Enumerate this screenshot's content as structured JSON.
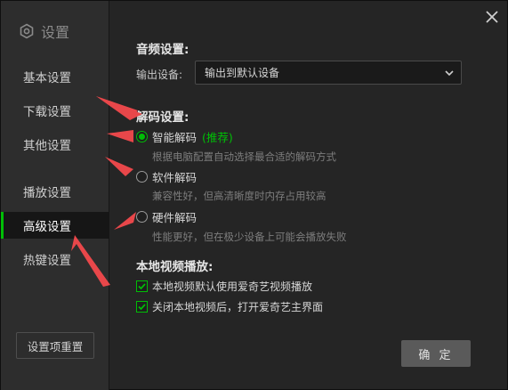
{
  "sidebar": {
    "title": "设置",
    "items": [
      {
        "label": "基本设置"
      },
      {
        "label": "下载设置"
      },
      {
        "label": "其他设置"
      },
      {
        "label": "播放设置"
      },
      {
        "label": "高级设置",
        "active": true
      },
      {
        "label": "热键设置"
      }
    ],
    "reset_label": "设置项重置"
  },
  "audio": {
    "title": "音频设置:",
    "output_label": "输出设备:",
    "output_value": "输出到默认设备"
  },
  "decode": {
    "title": "解码设置:",
    "smart_label": "智能解码",
    "smart_tag": "(推荐)",
    "smart_desc": "根据电脑配置自动选择最合适的解码方式",
    "software_label": "软件解码",
    "software_desc": "兼容性好，但高清晰度时内存占用较高",
    "hardware_label": "硬件解码",
    "hardware_desc": "性能更好，但在极少设备上可能会播放失败",
    "selected": "smart"
  },
  "local": {
    "title": "本地视频播放:",
    "option1": "本地视频默认使用爱奇艺视频播放",
    "option2": "关闭本地视频后，打开爱奇艺主界面",
    "option1_checked": true,
    "option2_checked": true
  },
  "footer": {
    "ok_label": "确 定"
  },
  "colors": {
    "accent": "#00be06",
    "annotation_arrow": "#e8474a",
    "background": "#252525",
    "sidebar": "#2d2d2d"
  }
}
